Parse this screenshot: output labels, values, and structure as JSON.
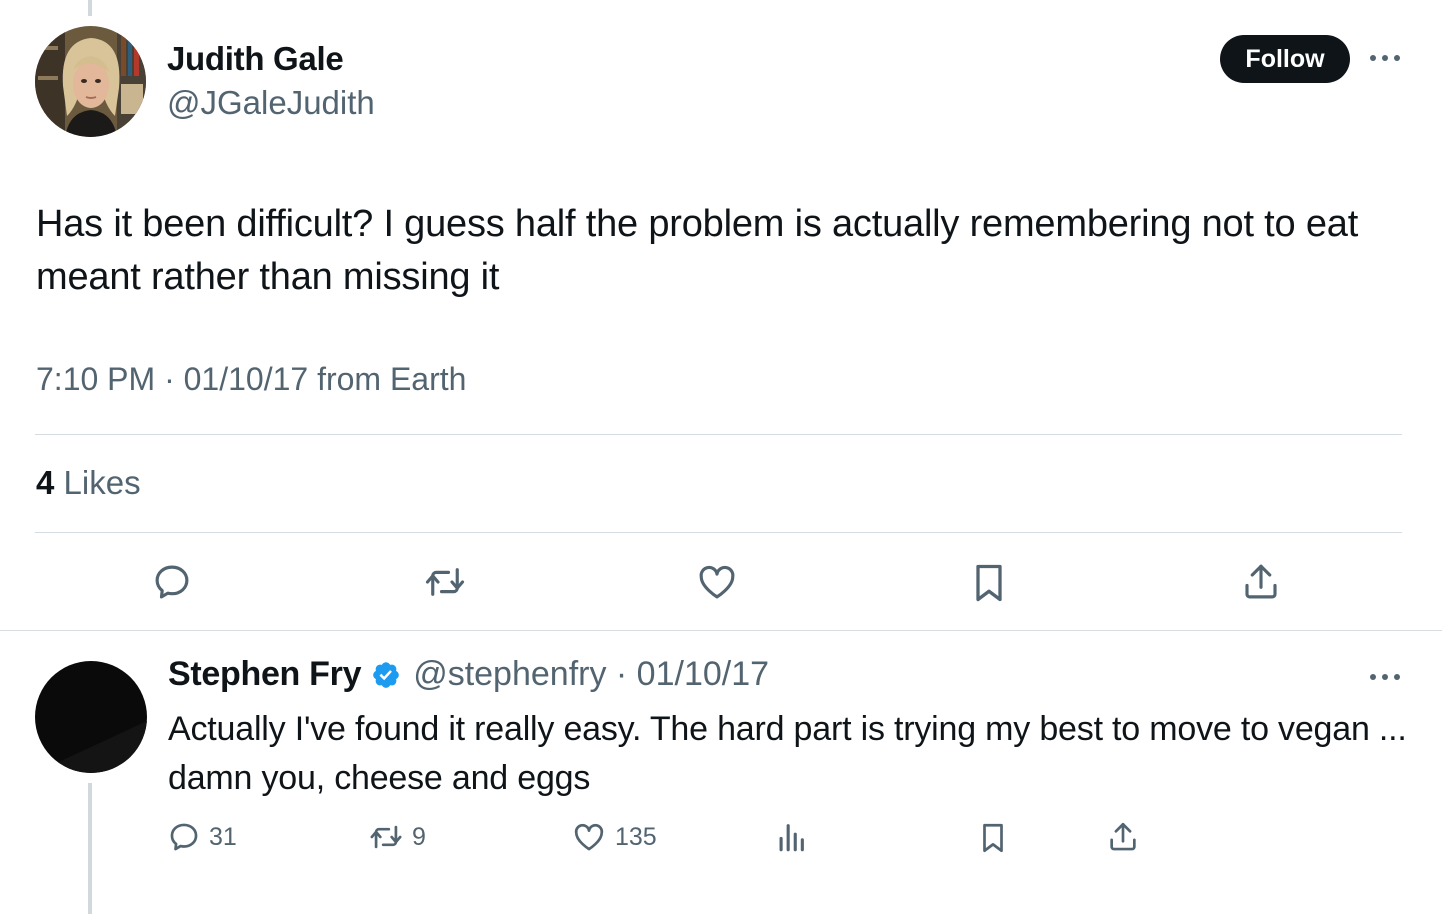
{
  "tweet": {
    "author_name": "Judith Gale",
    "author_handle": "@JGaleJudith",
    "follow_label": "Follow",
    "text": "Has it been difficult? I guess half the problem is actually remembering not to eat meant rather than missing it",
    "timestamp": "7:10 PM · 01/10/17 from Earth",
    "likes_count": "4",
    "likes_label": "Likes",
    "actions": [
      "reply-icon",
      "retweet-icon",
      "like-icon",
      "bookmark-icon",
      "share-icon"
    ]
  },
  "reply": {
    "author_name": "Stephen Fry",
    "verified": true,
    "handle_and_date": "@stephenfry · 01/10/17",
    "text": "Actually I've found it really easy. The hard part is trying my best to move to vegan ... damn you, cheese and eggs",
    "reply_count": "31",
    "retweet_count": "9",
    "like_count": "135",
    "actions": [
      "reply-icon",
      "retweet-icon",
      "like-icon",
      "views-icon",
      "bookmark-icon",
      "share-icon"
    ]
  },
  "colors": {
    "text": "#0f1419",
    "secondary": "#536471",
    "divider": "#d5dde2",
    "thread_line": "#cfd9de",
    "verified": "#1d9bf0",
    "follow_bg": "#0f1419"
  }
}
